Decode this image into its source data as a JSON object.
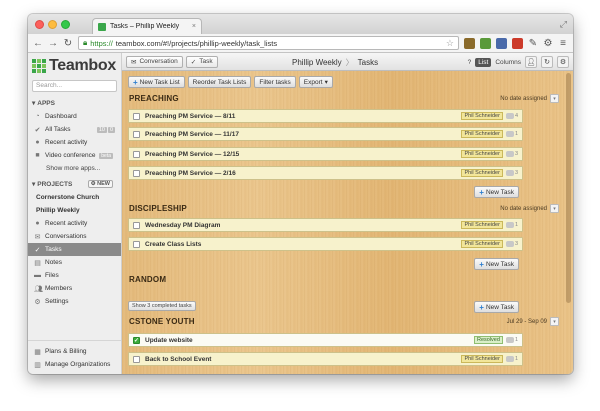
{
  "browser": {
    "tab_title": "Tasks – Phillip Weekly",
    "url_scheme": "https://",
    "url_rest": "teambox.com/#!/projects/phillip-weekly/task_lists",
    "tab_close": "×"
  },
  "sidebar": {
    "logo": "Teambox",
    "search_placeholder": "Search...",
    "apps_header": "APPS",
    "apps": [
      {
        "label": "Dashboard",
        "icon": "dashboard-icon"
      },
      {
        "label": "All Tasks",
        "icon": "check-circle-icon",
        "counts": [
          "10",
          "0"
        ]
      },
      {
        "label": "Recent activity",
        "icon": "dot-icon"
      },
      {
        "label": "Video conference",
        "icon": "video-icon",
        "badge": "beta"
      }
    ],
    "show_more": "Show more apps...",
    "projects_header": "PROJECTS",
    "new_label": "NEW",
    "projects": [
      "Cornerstone Church",
      "Phillip Weekly"
    ],
    "project_items": [
      {
        "label": "Recent activity",
        "icon": "dot-icon"
      },
      {
        "label": "Conversations",
        "icon": "chat-icon"
      },
      {
        "label": "Tasks",
        "icon": "check-icon",
        "active": true
      },
      {
        "label": "Notes",
        "icon": "note-icon"
      },
      {
        "label": "Files",
        "icon": "folder-icon"
      },
      {
        "label": "Members",
        "icon": "people-icon"
      },
      {
        "label": "Settings",
        "icon": "gear-icon"
      }
    ],
    "bottom": [
      {
        "label": "Plans & Billing",
        "icon": "billing-icon"
      },
      {
        "label": "Manage Organizations",
        "icon": "building-icon"
      }
    ]
  },
  "header": {
    "conversation_btn": "Conversation",
    "task_btn": "Task",
    "project": "Phillip Weekly",
    "page": "Tasks",
    "list_toggle": "List",
    "columns_toggle": "Columns"
  },
  "toolbar": {
    "new_list": "New Task List",
    "reorder": "Reorder Task Lists",
    "filter": "Filter tasks",
    "export": "Export"
  },
  "lists": [
    {
      "name": "PREACHING",
      "meta": "No date assigned",
      "tasks": [
        {
          "title": "Preaching PM Service — 8/11",
          "assignee": "Phil Schneider",
          "comments": "4"
        },
        {
          "title": "Preaching PM Service — 11/17",
          "assignee": "Phil Schneider",
          "comments": "1"
        },
        {
          "title": "Preaching PM Service — 12/15",
          "assignee": "Phil Schneider",
          "comments": "3"
        },
        {
          "title": "Preaching PM Service — 2/16",
          "assignee": "Phil Schneider",
          "comments": "3"
        }
      ],
      "new_task": "New Task"
    },
    {
      "name": "DISCIPLESHIP",
      "meta": "No date assigned",
      "tasks": [
        {
          "title": "Wednesday PM Diagram",
          "assignee": "Phil Schneider",
          "comments": "1"
        },
        {
          "title": "Create Class Lists",
          "assignee": "Phil Schneider",
          "comments": "3"
        }
      ],
      "new_task": "New Task"
    },
    {
      "name": "RANDOM",
      "meta": "",
      "show_completed": "Show 3 completed tasks",
      "new_task": "New Task"
    },
    {
      "name": "CSTONE YOUTH",
      "meta": "Jul 29 - Sep 09",
      "tasks": [
        {
          "title": "Update website",
          "assignee": "Resolved",
          "comments": "1",
          "done": true
        },
        {
          "title": "Back to School Event",
          "assignee": "Phil Schneider",
          "comments": "1"
        }
      ]
    }
  ]
}
